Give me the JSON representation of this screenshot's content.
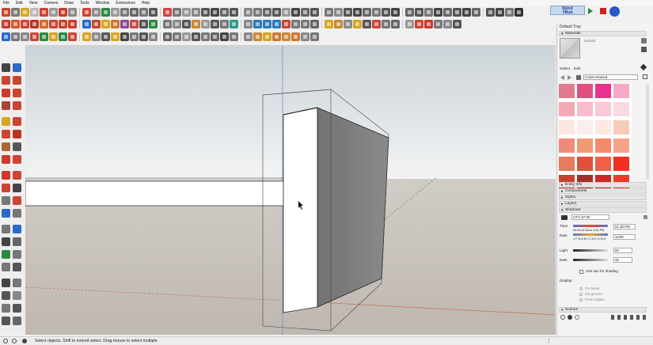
{
  "menu": [
    "File",
    "Edit",
    "View",
    "Camera",
    "Draw",
    "Tools",
    "Window",
    "Extensions",
    "Help"
  ],
  "toolbar_colors": {
    "row1": [
      "#c8462a",
      "#7a7a7a",
      "#d6a522",
      "#bbbbbb",
      "#d04030",
      "#9a9a9a",
      "#cc3a2a",
      "#8a8a8a",
      "#cc4433",
      "#8b8b8b",
      "#2a8a44",
      "#9a9a9a",
      "#777777",
      "#666666",
      "#777777",
      "#555555",
      "#c44",
      "#777777",
      "#999999",
      "#888888",
      "#555555",
      "#444444",
      "#666666",
      "#555555",
      "#888888",
      "#777777",
      "#666666",
      "#555555",
      "#999999",
      "#444444",
      "#666666",
      "#555555",
      "#777777",
      "#888888",
      "#555555",
      "#444444",
      "#666666",
      "#777777",
      "#555555",
      "#444444",
      "#666666",
      "#555555",
      "#777777",
      "#444444",
      "#666666",
      "#555555",
      "#444444",
      "#666666",
      "#555555",
      "#444444",
      "#777777",
      "#333333"
    ],
    "row2": [
      "#cc3a2a",
      "#d05a2a",
      "#cc4433",
      "#bb3322",
      "#d06a2a",
      "#cc4433",
      "#c8462a",
      "#cc3a2a",
      "#2a6ac8",
      "#c8462a",
      "#d6a522",
      "#cc7733",
      "#8a4a9a",
      "#c84a44",
      "#555555",
      "#2a8a44",
      "#777777",
      "#888888",
      "#555555",
      "#cc8833",
      "#999999",
      "#555555",
      "#777777",
      "#2a9a8a",
      "#888888",
      "#2a7ab8",
      "#2a7ab8",
      "#2a7ab8",
      "#cc4433",
      "#777777",
      "#777777",
      "#666666",
      "#d6a522",
      "#cc8833",
      "#888888",
      "#d6a522",
      "#555555",
      "#cc4433",
      "#777777",
      "#666666",
      "#999999",
      "#cc4433",
      "#cc3a2a",
      "#777777",
      "#888888",
      "#555555"
    ],
    "row3": [
      "#2a6ac8",
      "#7a7a7a",
      "#8a8a8a",
      "#cc4433",
      "#2a8a44",
      "#d6a522",
      "#2a8a44",
      "#cc4433",
      "#d6a522",
      "#8a8a8a",
      "#555555",
      "#d6a522",
      "#444444",
      "#777777",
      "#555555",
      "#888888",
      "#666666",
      "#777777",
      "#999999",
      "#555555",
      "#777777",
      "#666666",
      "#444444",
      "#777777",
      "#888888",
      "#cc8833",
      "#d6a522",
      "#cc7733",
      "#cc8833",
      "#cc7733",
      "#888888",
      "#777777"
    ]
  },
  "skinx": {
    "line1": "SkinX",
    "line2": "YBub"
  },
  "left_tool_colors": [
    [
      "#444444",
      "#2a6ac8"
    ],
    [
      "#cc4433",
      "#c8462a"
    ],
    [
      "#cc3a2a",
      "#cc4433"
    ],
    [
      "#aa4433",
      "#cc4433"
    ],
    [
      "#d6a522",
      "#cc4433"
    ],
    [
      "#cc4433",
      "#bb3322"
    ],
    [
      "#aa6633",
      "#555555"
    ],
    [
      "#cc3a2a",
      "#cc4433"
    ],
    [
      "#cc3a2a",
      "#cc4433"
    ],
    [
      "#cc4433",
      "#444444"
    ],
    [
      "#777777",
      "#cc4433"
    ],
    [
      "#2a6ac8",
      "#777777"
    ],
    [
      "#777777",
      "#2a6ac8"
    ],
    [
      "#444444",
      "#666666"
    ],
    [
      "#2a8a44",
      "#777777"
    ],
    [
      "#777777",
      "#555555"
    ],
    [
      "#444444",
      "#777777"
    ],
    [
      "#555555",
      "#888888"
    ],
    [
      "#777777",
      "#555555"
    ],
    [
      "#555555",
      "#666666"
    ]
  ],
  "status": {
    "text": "Select objects. Shift to extend select. Drag mouse to select multiple."
  },
  "tray": {
    "title": "Default Tray",
    "materials_header": "Materials",
    "material_name": "Default",
    "tabs": {
      "select": "Select",
      "edit": "Edit"
    },
    "library": "Colors-Named",
    "swatches": [
      [
        "#e07a8c",
        "#e0507e",
        "#e8318a",
        "#f5a8c8"
      ],
      [
        "#f4aab4",
        "#f8bccc",
        "#f9c9d5",
        "#fbd9e0"
      ],
      [
        "#fce6de",
        "#faeeec",
        "#fde8e2",
        "#f6ccb8"
      ],
      [
        "#f08a7a",
        "#ee9a74",
        "#f58a6a",
        "#f8a28a"
      ],
      [
        "#e87a5e",
        "#e0503a",
        "#f06048",
        "#f03020"
      ],
      [
        "#c84030",
        "#a03025",
        "#d02828",
        "#ee3a2a"
      ]
    ],
    "sections": [
      "Entity Info",
      "Components",
      "Styles",
      "Layers"
    ],
    "shadows_header": "Shadows",
    "timezone": "UTC-07:00",
    "time_label": "Time",
    "time_ticks": "06:45 AI  Noon  4:46 PM",
    "time_value": "01:30 PM",
    "date_label": "Date",
    "date_ticks": "J F M A M J J A S O N D",
    "date_value": "11/08",
    "light_label": "Light",
    "light_value": "80",
    "dark_label": "Dark",
    "dark_value": "45",
    "use_sun": "Use sun for shading",
    "display_label": "Display:",
    "display_options": [
      "On faces",
      "On ground",
      "From edges"
    ],
    "scenes_header": "Scenes"
  },
  "colors": {
    "accent": "#1a3a88",
    "selection_blue": "#3a5ad8",
    "panel_bg": "#f3f3f3"
  }
}
